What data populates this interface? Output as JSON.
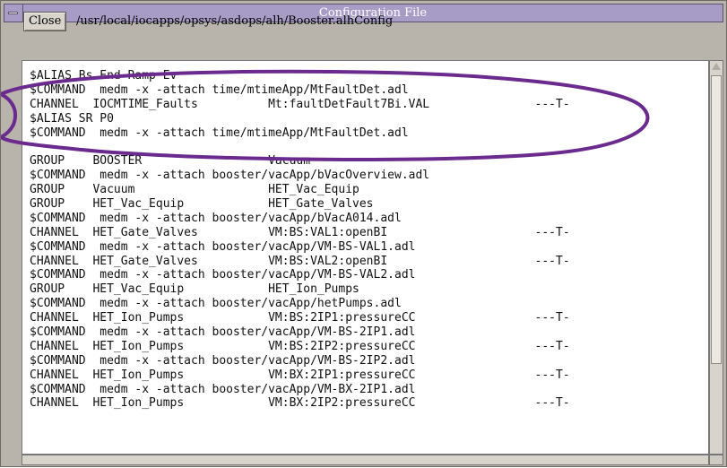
{
  "window": {
    "title": "Configuration File"
  },
  "toolbar": {
    "close_label": "Close",
    "file_path": "/usr/local/iocapps/opsys/asdops/alh/Booster.alhConfig"
  },
  "file_lines": [
    "$ALIAS Bs End Ramp Ev",
    "$COMMAND  medm -x -attach time/mtimeApp/MtFaultDet.adl",
    "CHANNEL  IOCMTIME_Faults          Mt:faultDetFault7Bi.VAL               ---T-",
    "$ALIAS SR P0",
    "$COMMAND  medm -x -attach time/mtimeApp/MtFaultDet.adl",
    "",
    "GROUP    BOOSTER                  Vacuum",
    "$COMMAND  medm -x -attach booster/vacApp/bVacOverview.adl",
    "GROUP    Vacuum                   HET_Vac_Equip",
    "GROUP    HET_Vac_Equip            HET_Gate_Valves",
    "$COMMAND  medm -x -attach booster/vacApp/bVacA014.adl",
    "CHANNEL  HET_Gate_Valves          VM:BS:VAL1:openBI                     ---T-",
    "$COMMAND  medm -x -attach booster/vacApp/VM-BS-VAL1.adl",
    "CHANNEL  HET_Gate_Valves          VM:BS:VAL2:openBI                     ---T-",
    "$COMMAND  medm -x -attach booster/vacApp/VM-BS-VAL2.adl",
    "GROUP    HET_Vac_Equip            HET_Ion_Pumps",
    "$COMMAND  medm -x -attach booster/vacApp/hetPumps.adl",
    "CHANNEL  HET_Ion_Pumps            VM:BS:2IP1:pressureCC                 ---T-",
    "$COMMAND  medm -x -attach booster/vacApp/VM-BS-2IP1.adl",
    "CHANNEL  HET_Ion_Pumps            VM:BS:2IP2:pressureCC                 ---T-",
    "$COMMAND  medm -x -attach booster/vacApp/VM-BS-2IP2.adl",
    "CHANNEL  HET_Ion_Pumps            VM:BX:2IP1:pressureCC                 ---T-",
    "$COMMAND  medm -x -attach booster/vacApp/VM-BX-2IP1.adl",
    "CHANNEL  HET_Ion_Pumps            VM:BX:2IP2:pressureCC                 ---T-"
  ],
  "annotation": {
    "stroke_color": "#6a2a8e"
  },
  "colors": {
    "titlebar": "#a79cc6",
    "window_bg": "#b8b4ac",
    "text_bg": "#ffffff"
  }
}
